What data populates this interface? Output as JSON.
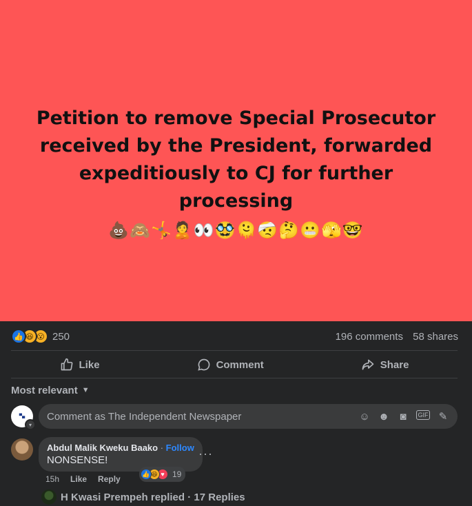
{
  "post": {
    "headline": "Petition to remove Special Prosecutor\nreceived by the President, forwarded\nexpeditiously to CJ for further processing",
    "emojis": "💩🙈🤸🙎👀🥸🫠🤕🤔😬🫣🤓",
    "bg_color": "#fe5555"
  },
  "stats": {
    "reaction_count": "250",
    "comments": "196 comments",
    "shares": "58 shares",
    "reaction_icons": [
      "like-icon",
      "haha-icon",
      "wow-icon"
    ]
  },
  "actions": {
    "like": "Like",
    "comment": "Comment",
    "share": "Share"
  },
  "sort": {
    "label": "Most relevant"
  },
  "composer": {
    "placeholder": "Comment as The Independent Newspaper",
    "icons": [
      "sticker-icon",
      "emoji-icon",
      "camera-icon",
      "gif-icon",
      "avatar-sticker-icon"
    ]
  },
  "comment": {
    "author": "Abdul Malik Kweku Baako",
    "separator": " · ",
    "follow": "Follow",
    "text": "NONSENSE!",
    "time": "15h",
    "like": "Like",
    "reply": "Reply",
    "reaction_count": "19"
  },
  "replies": {
    "text": "H Kwasi Prempeh replied · 17 Replies"
  }
}
